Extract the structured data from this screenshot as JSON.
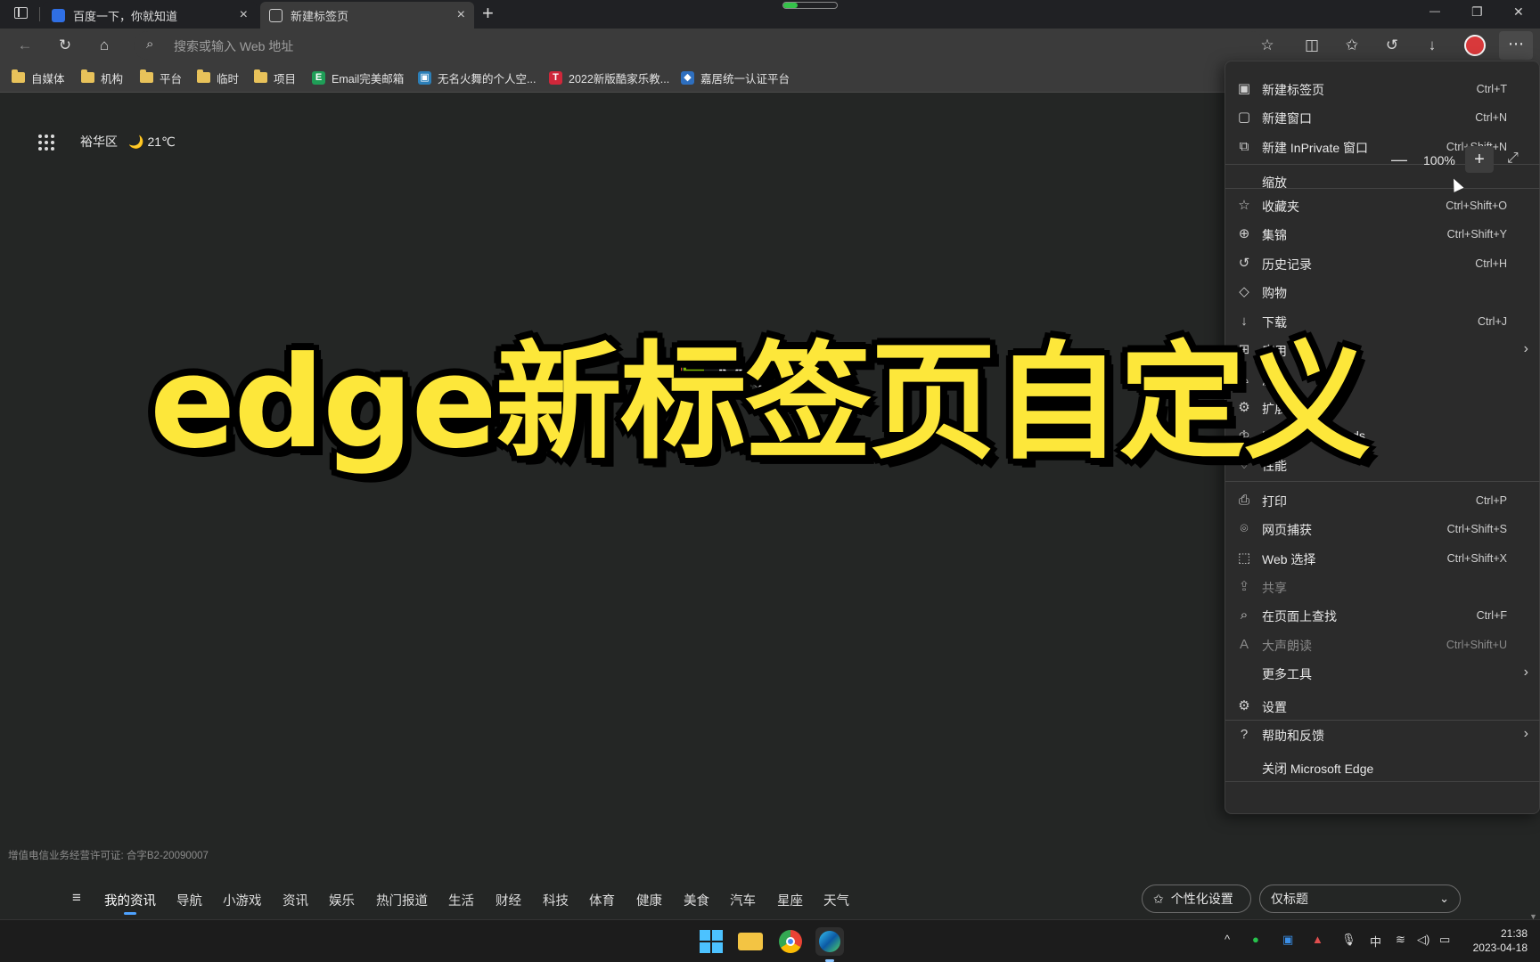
{
  "tabs": [
    {
      "title": "百度一下，你就知道",
      "close": "×"
    },
    {
      "title": "新建标签页",
      "close": "×"
    }
  ],
  "new_tab_symbol": "+",
  "window_controls": {
    "minimize": "—",
    "maximize": "❐",
    "close": "✕"
  },
  "address_bar": {
    "placeholder": "搜索或输入 Web 地址"
  },
  "bookmarks": [
    {
      "label": "自媒体",
      "type": "folder"
    },
    {
      "label": "机构",
      "type": "folder"
    },
    {
      "label": "平台",
      "type": "folder"
    },
    {
      "label": "临时",
      "type": "folder"
    },
    {
      "label": "项目",
      "type": "folder"
    },
    {
      "label": "Email完美邮箱",
      "type": "site",
      "badge": "E",
      "color": "#1f9e57"
    },
    {
      "label": "无名火舞的个人空...",
      "type": "site",
      "badge": "▣",
      "color": "#2c7fb8"
    },
    {
      "label": "2022新版酷家乐教...",
      "type": "site",
      "badge": "T",
      "color": "#d0273a"
    },
    {
      "label": "嘉居统一认证平台",
      "type": "site",
      "badge": "◆",
      "color": "#2e6fbf"
    }
  ],
  "weather": {
    "location": "裕华区",
    "temp": "21℃",
    "icon": "🌙"
  },
  "logo_text": "Microsoft",
  "overlay_title": "edge新标签页自定义",
  "license": "增值电信业务经营许可证: 合字B2-20090007",
  "news_nav": [
    "我的资讯",
    "导航",
    "小游戏",
    "资讯",
    "娱乐",
    "热门报道",
    "生活",
    "财经",
    "科技",
    "体育",
    "健康",
    "美食",
    "汽车",
    "星座",
    "天气"
  ],
  "personalize_label": "个性化设置",
  "layout_select": "仅标题",
  "menu": {
    "items": [
      {
        "label": "新建标签页",
        "shortcut": "Ctrl+T",
        "icon": "▣"
      },
      {
        "label": "新建窗口",
        "shortcut": "Ctrl+N",
        "icon": "▢"
      },
      {
        "label": "新建 InPrivate 窗口",
        "shortcut": "Ctrl+Shift+N",
        "icon": "⧉"
      },
      {
        "label": "收藏夹",
        "shortcut": "Ctrl+Shift+O",
        "icon": "☆"
      },
      {
        "label": "集锦",
        "shortcut": "Ctrl+Shift+Y",
        "icon": "⊕"
      },
      {
        "label": "历史记录",
        "shortcut": "Ctrl+H",
        "icon": "↺"
      },
      {
        "label": "购物",
        "shortcut": "",
        "icon": "◇"
      },
      {
        "label": "下载",
        "shortcut": "Ctrl+J",
        "icon": "↓"
      },
      {
        "label": "应用",
        "shortcut": "",
        "icon": "⊞",
        "submenu": true
      },
      {
        "label": "游戏",
        "shortcut": "",
        "icon": "♙"
      },
      {
        "label": "扩展",
        "shortcut": "",
        "icon": "⚙"
      },
      {
        "label": "Microsoft Rewards",
        "shortcut": "",
        "icon": "♔"
      },
      {
        "label": "性能",
        "shortcut": "",
        "icon": "♡"
      },
      {
        "label": "打印",
        "shortcut": "Ctrl+P",
        "icon": "⎙"
      },
      {
        "label": "网页捕获",
        "shortcut": "Ctrl+Shift+S",
        "icon": "⌾"
      },
      {
        "label": "Web 选择",
        "shortcut": "Ctrl+Shift+X",
        "icon": "⬚"
      },
      {
        "label": "共享",
        "shortcut": "",
        "icon": "⇪",
        "disabled": true
      },
      {
        "label": "在页面上查找",
        "shortcut": "Ctrl+F",
        "icon": "⌕"
      },
      {
        "label": "大声朗读",
        "shortcut": "Ctrl+Shift+U",
        "icon": "A",
        "disabled": true
      },
      {
        "label": "更多工具",
        "shortcut": "",
        "icon": "",
        "submenu": true
      },
      {
        "label": "设置",
        "shortcut": "",
        "icon": "⚙"
      },
      {
        "label": "帮助和反馈",
        "shortcut": "",
        "icon": "?",
        "submenu": true
      },
      {
        "label": "关闭 Microsoft Edge",
        "shortcut": "",
        "icon": ""
      }
    ],
    "zoom": {
      "label": "缩放",
      "value": "100%",
      "minus": "—",
      "plus": "+",
      "fullscreen": "⤢"
    },
    "arrow": "›"
  },
  "taskbar": {
    "clock_time": "21:38",
    "clock_date": "2023-04-18",
    "ime": "中"
  },
  "colors": {
    "accent": "#4ea2ff",
    "overlay_text": "#fde73a",
    "ms_red": "#f25022",
    "ms_green": "#7fba00",
    "ms_blue": "#00a4ef",
    "ms_yellow": "#ffb900"
  }
}
